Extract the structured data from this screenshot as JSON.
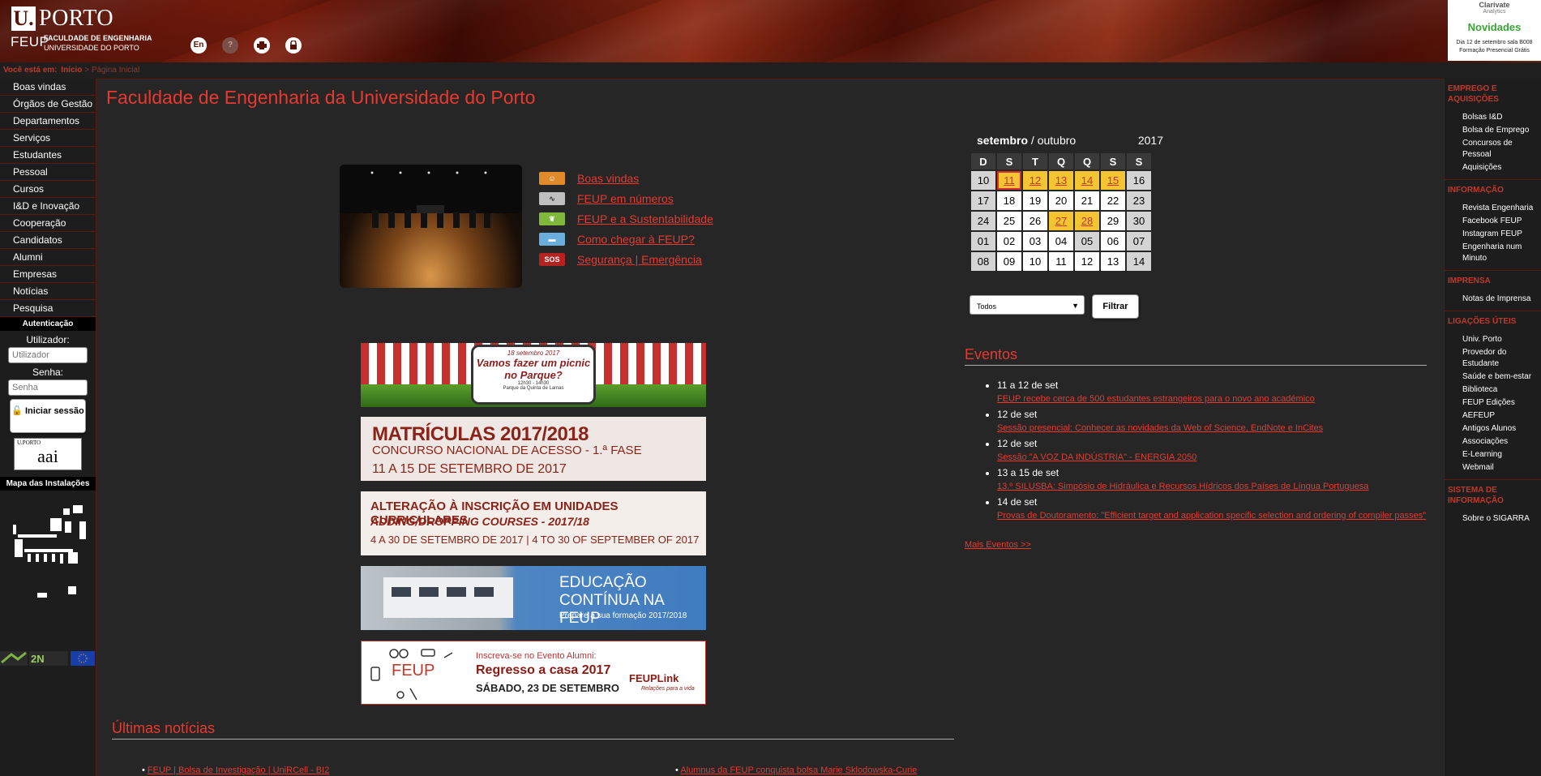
{
  "header": {
    "logo_u": "U.",
    "logo_porto": "PORTO",
    "logo_feup": "FEUP",
    "logo_faculdade": "FACULDADE DE ENGENHARIA",
    "logo_universidade": "UNIVERSIDADE DO PORTO",
    "icons": {
      "lang": "En",
      "help": "?",
      "print": "print-icon",
      "lock": "lock-icon"
    }
  },
  "ad": {
    "brand": "Clarivate",
    "brand_sub": "Analytics",
    "title": "Novidades",
    "line1": "Dia 12 de setembro sala B008",
    "line2": "Formação Presencial Grátis"
  },
  "breadcrumb": {
    "label": "Você está em:",
    "home": "Início",
    "sep": " > ",
    "current": "Página Inicial"
  },
  "left_menu": [
    "Boas vindas",
    "Órgãos de Gestão",
    "Departamentos",
    "Serviços",
    "Estudantes",
    "Pessoal",
    "Cursos",
    "I&D e Inovação",
    "Cooperação",
    "Candidatos",
    "Alumni",
    "Empresas",
    "Notícias",
    "Pesquisa"
  ],
  "auth": {
    "heading": "Autenticação",
    "user_label": "Utilizador:",
    "user_placeholder": "Utilizador",
    "pass_label": "Senha:",
    "pass_placeholder": "Senha",
    "login_button": "Iniciar sessão",
    "aai_small": "U.PORTO",
    "aai_text": "aai"
  },
  "map_heading": "Mapa das Instalações",
  "page_title": "Faculdade de Engenharia da Universidade do Porto",
  "quick_links": [
    {
      "label": "Boas vindas",
      "icon": "welcome-icon",
      "color": "#e08a2e"
    },
    {
      "label": "FEUP em números",
      "icon": "stats-icon",
      "color": "#bfbfbf"
    },
    {
      "label": "FEUP e a Sustentabilidade",
      "icon": "leaf-icon",
      "color": "#7fb83b"
    },
    {
      "label": "Como chegar à FEUP?",
      "icon": "bus-icon",
      "color": "#6aaedc"
    },
    {
      "label": "Segurança | Emergência",
      "icon": "sos-icon",
      "color": "#b52222",
      "text": "SOS"
    }
  ],
  "banners": {
    "b1": {
      "date": "18 setembro 2017",
      "title": "Vamos fazer um picnic no Parque?",
      "time": "12h30 - 14h30",
      "place": "Parque da Quinta de Lamas"
    },
    "b2": {
      "title": "MATRÍCULAS 2017/2018",
      "subtitle": "CONCURSO NACIONAL DE ACESSO - 1.ª FASE",
      "dates": "11 A 15 DE SETEMBRO DE 2017"
    },
    "b3": {
      "title": "ALTERAÇÃO À INSCRIÇÃO EM UNIDADES CURRICULARES",
      "subtitle": "ADDING/DROPPING COURSES - 2017/18",
      "dates": "4 A 30 DE SETEMBRO DE 2017 | 4 TO 30 OF SEPTEMBER OF 2017"
    },
    "b4": {
      "title1": "EDUCAÇÃO",
      "title2": "CONTÍNUA NA FEUP",
      "subtitle": "Prepare a sua formação 2017/2018"
    },
    "b5": {
      "feup": "FEUP",
      "line1": "Inscreva-se no Evento Alumni:",
      "line2": "Regresso a casa 2017",
      "line3": "SÁBADO, 23 DE SETEMBRO",
      "brand": "FEUPLink",
      "tagline": "Relações para a vida"
    }
  },
  "news_heading": "Últimas notícias",
  "news": [
    "FEUP | Bolsa de Investigação | UniRCell - BI2",
    "Alumnus da FEUP conquista bolsa Marie Sklodowska-Curie"
  ],
  "calendar": {
    "month_current": "setembro",
    "month_sep": " / ",
    "month_next": "outubro",
    "year": "2017",
    "weekdays": [
      "D",
      "S",
      "T",
      "Q",
      "Q",
      "S",
      "S"
    ],
    "weeks": [
      [
        "10",
        "11",
        "12",
        "13",
        "14",
        "15",
        "16"
      ],
      [
        "17",
        "18",
        "19",
        "20",
        "21",
        "22",
        "23"
      ],
      [
        "24",
        "25",
        "26",
        "27",
        "28",
        "29",
        "30"
      ],
      [
        "01",
        "02",
        "03",
        "04",
        "05",
        "06",
        "07"
      ],
      [
        "08",
        "09",
        "10",
        "11",
        "12",
        "13",
        "14"
      ]
    ],
    "event_days": [
      "11",
      "12",
      "13",
      "14",
      "15",
      "27",
      "28"
    ],
    "today": "11",
    "filter_value": "Todos",
    "filter_button": "Filtrar"
  },
  "events_heading": "Eventos",
  "events": [
    {
      "date": "11 a 12 de set",
      "title": "FEUP recebe cerca de 500 estudantes estrangeiros para o novo ano académico"
    },
    {
      "date": "12 de set",
      "title": "Sessão presencial: Conhecer as novidades da Web of Science, EndNote e InCites"
    },
    {
      "date": "12 de set",
      "title": "Sessão \"A VOZ DA INDÚSTRIA\" - ENERGIA 2050"
    },
    {
      "date": "13 a 15 de set",
      "title": "13.º SILUSBA: Simpósio de Hidráulica e Recursos Hídricos dos Países de Língua Portuguesa"
    },
    {
      "date": "14 de set",
      "title": "Provas de Doutoramento: \"Efficient target and application specific selection and ordering of compiler passes\""
    }
  ],
  "more_events": "Mais Eventos >>",
  "right_sections": [
    {
      "heading": "EMPREGO E AQUISIÇÕES",
      "items": [
        "Bolsas I&D",
        "Bolsa de Emprego",
        "Concursos de Pessoal",
        "Aquisições"
      ]
    },
    {
      "heading": "INFORMAÇÃO",
      "items": [
        "Revista Engenharia",
        "Facebook FEUP",
        "Instagram FEUP",
        "Engenharia num Minuto"
      ]
    },
    {
      "heading": "IMPRENSA",
      "items": [
        "Notas de Imprensa"
      ]
    },
    {
      "heading": "LIGAÇÕES ÚTEIS",
      "items": [
        "Univ. Porto",
        "Provedor do Estudante",
        "Saúde e bem-estar",
        "Biblioteca",
        "FEUP Edições",
        "AEFEUP",
        "Antigos Alunos",
        "Associações",
        "E-Learning",
        "Webmail"
      ]
    },
    {
      "heading": "SISTEMA DE INFORMAÇÃO",
      "items": [
        "Sobre o SIGARRA"
      ]
    }
  ],
  "colors": {
    "accent": "#e8392f",
    "header_dark": "#5b1206",
    "event_day": "#f5c433",
    "background": "#262626"
  }
}
